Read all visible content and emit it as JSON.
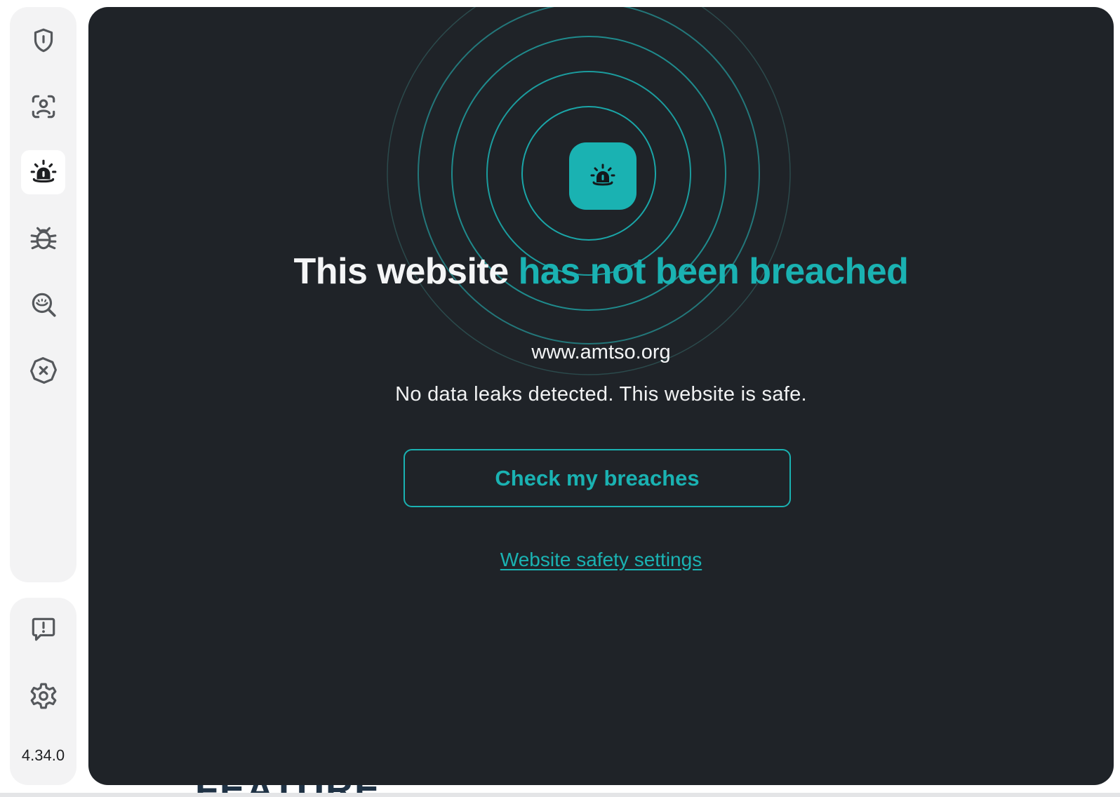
{
  "app": {
    "version": "4.34.0"
  },
  "sidebar": {
    "items": [
      {
        "icon": "shield-icon",
        "active": false
      },
      {
        "icon": "face-scan-icon",
        "active": false
      },
      {
        "icon": "siren-alarm-icon",
        "active": true
      },
      {
        "icon": "bug-icon",
        "active": false
      },
      {
        "icon": "magnifier-eye-icon",
        "active": false
      },
      {
        "icon": "blocked-octagon-icon",
        "active": false
      }
    ],
    "bottom_items": [
      {
        "icon": "feedback-message-icon"
      },
      {
        "icon": "settings-gear-icon"
      }
    ]
  },
  "main": {
    "badge_icon": "siren-alarm-icon",
    "headline_part1": "This website ",
    "headline_part2": "has not been breached",
    "domain": "www.amtso.org",
    "message": "No data leaks detected. This website is safe.",
    "cta_label": "Check my breaches",
    "settings_link": "Website safety settings"
  },
  "background_page": {
    "partial_heading": "FEATURE"
  },
  "colors": {
    "accent": "#1ab2b2",
    "panel_bg": "#1f2328",
    "sidebar_bg": "#f3f3f4",
    "text_light": "#f4f5f6",
    "icon_gray": "#55585c"
  }
}
